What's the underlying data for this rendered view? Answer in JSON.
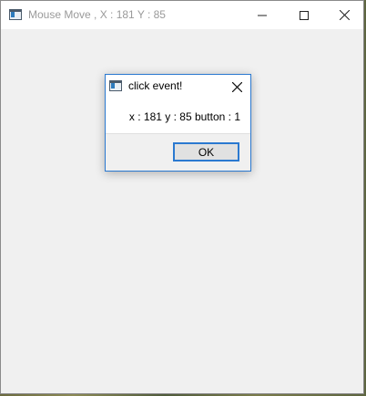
{
  "main_window": {
    "title": "Mouse Move , X : 181 Y : 85",
    "icon": "window-app-icon",
    "controls": {
      "minimize_icon": "minimize-icon",
      "maximize_icon": "maximize-icon",
      "close_icon": "close-icon"
    }
  },
  "dialog": {
    "title": "click event!",
    "icon": "window-app-icon",
    "close_icon": "close-icon",
    "message": "x : 181 y : 85 button : 1",
    "ok_label": "OK"
  },
  "colors": {
    "accent": "#2b79d0",
    "client_background": "#f0f0f0",
    "title_text_inactive": "#9a9a9a"
  }
}
